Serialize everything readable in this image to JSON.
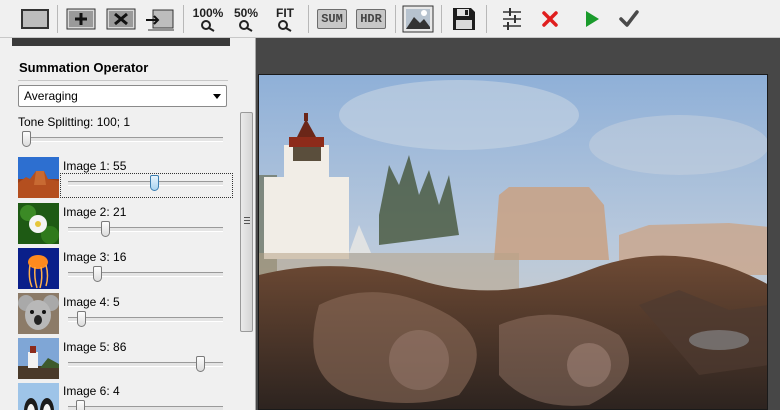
{
  "toolbar": {
    "zoom100": "100%",
    "zoom50": "50%",
    "zoomFit": "FIT",
    "sum": "SUM",
    "hdr": "HDR"
  },
  "panel": {
    "title": "Summation Operator",
    "operator_selected": "Averaging",
    "tone_label": "Tone Splitting: 100; 1",
    "tone_value": 0,
    "images": [
      {
        "label": "Image 1: 55",
        "weight": 55
      },
      {
        "label": "Image 2: 21",
        "weight": 21
      },
      {
        "label": "Image 3: 16",
        "weight": 16
      },
      {
        "label": "Image 4: 5",
        "weight": 5
      },
      {
        "label": "Image 5: 86",
        "weight": 86
      },
      {
        "label": "Image 6: 4",
        "weight": 4
      }
    ]
  },
  "colors": {
    "cancel_red": "#e01e1e",
    "run_green": "#1a9b2c",
    "ok_gray": "#4a4a4a",
    "viewer_bg": "#474747",
    "slider_active": "#a9d4f1"
  }
}
